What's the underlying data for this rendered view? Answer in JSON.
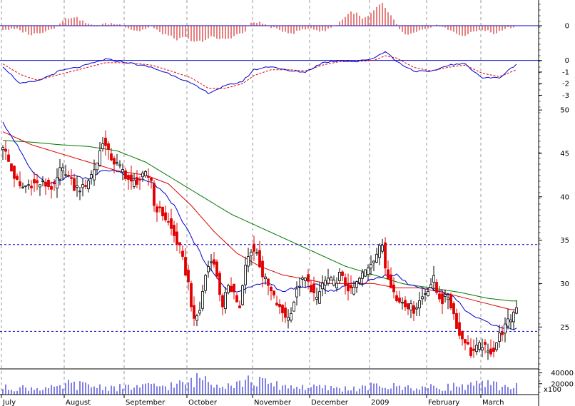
{
  "chart_data": {
    "type": "candlestick",
    "title": "",
    "colors": {
      "up_candle": "#000000",
      "down_candle": "#e00000",
      "ma_short": "#0000cc",
      "ma_medium": "#dd0000",
      "ma_long": "#007700",
      "histogram": "#cc0000",
      "signal": "#dd0000",
      "reference_line": "#0000cc",
      "volume": "#0000cc"
    },
    "x_axis": {
      "months": [
        {
          "label": "July",
          "bar": 0
        },
        {
          "label": "August",
          "bar": 22
        },
        {
          "label": "September",
          "bar": 43
        },
        {
          "label": "October",
          "bar": 65
        },
        {
          "label": "November",
          "bar": 88
        },
        {
          "label": "December",
          "bar": 108
        },
        {
          "label": "2009",
          "bar": 129
        },
        {
          "label": "February",
          "bar": 149
        },
        {
          "label": "March",
          "bar": 168
        }
      ],
      "total_bars": 181
    },
    "price_axis": {
      "ylim": [
        20.5,
        51
      ],
      "ticks": [
        25,
        30,
        35,
        40,
        45,
        50
      ],
      "reference_levels": [
        24.5,
        34.5
      ],
      "grid": "vertical-dashed"
    },
    "histogram_axis": {
      "ylim": [
        -3.2,
        3.2
      ],
      "ticks": [
        0
      ]
    },
    "momentum_axis": {
      "ylim": [
        -3.4,
        0.9
      ],
      "ticks": [
        0,
        -1,
        -2,
        -3
      ]
    },
    "volume_axis": {
      "ylim": [
        0,
        46000
      ],
      "ticks": [
        20000,
        40000
      ],
      "unit_label": "x100"
    },
    "price_anchors": [
      [
        0,
        46
      ],
      [
        3,
        43
      ],
      [
        6,
        41
      ],
      [
        10,
        41.5
      ],
      [
        14,
        41.5
      ],
      [
        18,
        41
      ],
      [
        20,
        43
      ],
      [
        22,
        43
      ],
      [
        25,
        41
      ],
      [
        28,
        41
      ],
      [
        31,
        42.5
      ],
      [
        33,
        44
      ],
      [
        35,
        46.5
      ],
      [
        37,
        45
      ],
      [
        39,
        44
      ],
      [
        42,
        43
      ],
      [
        45,
        41.5
      ],
      [
        48,
        42
      ],
      [
        50,
        42.5
      ],
      [
        52,
        42
      ],
      [
        53,
        39
      ],
      [
        56,
        38
      ],
      [
        58,
        37
      ],
      [
        60,
        35.5
      ],
      [
        62,
        34
      ],
      [
        65,
        30
      ],
      [
        67,
        25.5
      ],
      [
        69,
        27
      ],
      [
        71,
        31
      ],
      [
        73,
        33
      ],
      [
        75,
        31
      ],
      [
        77,
        27
      ],
      [
        79,
        30
      ],
      [
        81,
        29
      ],
      [
        83,
        27
      ],
      [
        85,
        32
      ],
      [
        87,
        34
      ],
      [
        89,
        33.5
      ],
      [
        91,
        31
      ],
      [
        94,
        29
      ],
      [
        97,
        27
      ],
      [
        100,
        26
      ],
      [
        102,
        28
      ],
      [
        104,
        30
      ],
      [
        106,
        30.5
      ],
      [
        108,
        29.5
      ],
      [
        110,
        28
      ],
      [
        112,
        30
      ],
      [
        114,
        30.5
      ],
      [
        116,
        30
      ],
      [
        118,
        31
      ],
      [
        120,
        30
      ],
      [
        122,
        29
      ],
      [
        124,
        30
      ],
      [
        126,
        31
      ],
      [
        128,
        32
      ],
      [
        130,
        33
      ],
      [
        132,
        34
      ],
      [
        133,
        34.5
      ],
      [
        134,
        32
      ],
      [
        136,
        30
      ],
      [
        138,
        28
      ],
      [
        140,
        28
      ],
      [
        142,
        27.5
      ],
      [
        144,
        27
      ],
      [
        146,
        28
      ],
      [
        148,
        29
      ],
      [
        150,
        30
      ],
      [
        151,
        30.5
      ],
      [
        152,
        29
      ],
      [
        154,
        28
      ],
      [
        156,
        28.5
      ],
      [
        158,
        26.5
      ],
      [
        160,
        24
      ],
      [
        162,
        23.5
      ],
      [
        164,
        22
      ],
      [
        166,
        22.5
      ],
      [
        168,
        23
      ],
      [
        170,
        22
      ],
      [
        172,
        22.5
      ],
      [
        174,
        24
      ],
      [
        176,
        25
      ],
      [
        178,
        26
      ],
      [
        180,
        27.5
      ]
    ],
    "histogram_anchors": [
      [
        0,
        -0.5
      ],
      [
        5,
        -0.5
      ],
      [
        10,
        -1.2
      ],
      [
        14,
        -0.8
      ],
      [
        18,
        -0.3
      ],
      [
        20,
        0.4
      ],
      [
        22,
        0.9
      ],
      [
        25,
        1.2
      ],
      [
        28,
        0.6
      ],
      [
        30,
        0.2
      ],
      [
        32,
        -0.1
      ],
      [
        35,
        0.2
      ],
      [
        38,
        0.3
      ],
      [
        42,
        0.1
      ],
      [
        45,
        -0.5
      ],
      [
        48,
        -0.7
      ],
      [
        50,
        -0.4
      ],
      [
        52,
        -0.1
      ],
      [
        55,
        -0.9
      ],
      [
        58,
        -1.3
      ],
      [
        61,
        -1.8
      ],
      [
        64,
        -1.6
      ],
      [
        67,
        -2.2
      ],
      [
        70,
        -2.0
      ],
      [
        73,
        -1.5
      ],
      [
        76,
        -1.8
      ],
      [
        79,
        -1.7
      ],
      [
        82,
        -1.2
      ],
      [
        85,
        -0.8
      ],
      [
        87,
        0.4
      ],
      [
        89,
        0.5
      ],
      [
        91,
        0.3
      ],
      [
        93,
        0.0
      ],
      [
        96,
        -0.5
      ],
      [
        99,
        -0.8
      ],
      [
        102,
        -1.0
      ],
      [
        104,
        -0.6
      ],
      [
        106,
        -0.5
      ],
      [
        108,
        -0.3
      ],
      [
        110,
        -0.6
      ],
      [
        112,
        -0.8
      ],
      [
        114,
        -0.4
      ],
      [
        116,
        -0.1
      ],
      [
        118,
        0.5
      ],
      [
        120,
        1.2
      ],
      [
        122,
        1.8
      ],
      [
        124,
        1.6
      ],
      [
        126,
        0.9
      ],
      [
        128,
        1.2
      ],
      [
        130,
        2.0
      ],
      [
        132,
        2.7
      ],
      [
        133,
        2.9
      ],
      [
        135,
        1.8
      ],
      [
        137,
        0.8
      ],
      [
        139,
        -0.6
      ],
      [
        141,
        -1.2
      ],
      [
        144,
        -1.0
      ],
      [
        147,
        -0.6
      ],
      [
        150,
        -0.4
      ],
      [
        152,
        0.2
      ],
      [
        154,
        -0.1
      ],
      [
        156,
        -0.5
      ],
      [
        158,
        -0.9
      ],
      [
        160,
        -1.2
      ],
      [
        162,
        -1.3
      ],
      [
        165,
        -0.8
      ],
      [
        168,
        -0.5
      ],
      [
        170,
        -0.7
      ],
      [
        172,
        -1.1
      ],
      [
        174,
        -0.8
      ],
      [
        176,
        -0.4
      ],
      [
        178,
        -0.2
      ],
      [
        180,
        -0.1
      ]
    ],
    "momentum_anchors": [
      [
        0,
        -0.5
      ],
      [
        6,
        -2.0
      ],
      [
        12,
        -1.8
      ],
      [
        20,
        -0.9
      ],
      [
        28,
        -0.5
      ],
      [
        36,
        0.1
      ],
      [
        44,
        -0.2
      ],
      [
        52,
        -0.6
      ],
      [
        60,
        -1.3
      ],
      [
        66,
        -2.0
      ],
      [
        72,
        -2.8
      ],
      [
        78,
        -2.2
      ],
      [
        84,
        -1.8
      ],
      [
        88,
        -0.8
      ],
      [
        94,
        -0.5
      ],
      [
        100,
        -0.9
      ],
      [
        106,
        -1.0
      ],
      [
        112,
        -0.2
      ],
      [
        118,
        0.0
      ],
      [
        124,
        -0.1
      ],
      [
        130,
        0.2
      ],
      [
        134,
        0.8
      ],
      [
        138,
        -0.1
      ],
      [
        144,
        -0.9
      ],
      [
        150,
        -1.0
      ],
      [
        156,
        -0.4
      ],
      [
        162,
        -0.3
      ],
      [
        168,
        -1.5
      ],
      [
        174,
        -1.5
      ],
      [
        180,
        -0.3
      ]
    ],
    "signal_anchors": [
      [
        0,
        -0.3
      ],
      [
        6,
        -1.2
      ],
      [
        12,
        -1.7
      ],
      [
        20,
        -1.2
      ],
      [
        28,
        -0.7
      ],
      [
        36,
        -0.2
      ],
      [
        44,
        -0.2
      ],
      [
        52,
        -0.4
      ],
      [
        60,
        -1.0
      ],
      [
        66,
        -1.5
      ],
      [
        72,
        -2.4
      ],
      [
        78,
        -2.4
      ],
      [
        84,
        -2.0
      ],
      [
        88,
        -1.3
      ],
      [
        94,
        -0.8
      ],
      [
        100,
        -0.8
      ],
      [
        106,
        -0.9
      ],
      [
        112,
        -0.4
      ],
      [
        118,
        -0.1
      ],
      [
        124,
        -0.1
      ],
      [
        130,
        0.0
      ],
      [
        134,
        0.4
      ],
      [
        138,
        0.2
      ],
      [
        144,
        -0.6
      ],
      [
        150,
        -0.9
      ],
      [
        156,
        -0.6
      ],
      [
        162,
        -0.4
      ],
      [
        168,
        -1.1
      ],
      [
        174,
        -1.4
      ],
      [
        180,
        -0.8
      ]
    ],
    "volume_anchors": [
      [
        0,
        12000
      ],
      [
        20,
        11000
      ],
      [
        22,
        18000
      ],
      [
        40,
        12000
      ],
      [
        60,
        16000
      ],
      [
        65,
        20000
      ],
      [
        70,
        30000
      ],
      [
        75,
        22000
      ],
      [
        80,
        18000
      ],
      [
        88,
        25000
      ],
      [
        95,
        16000
      ],
      [
        110,
        12000
      ],
      [
        125,
        10000
      ],
      [
        130,
        15000
      ],
      [
        140,
        13000
      ],
      [
        150,
        12000
      ],
      [
        160,
        15000
      ],
      [
        170,
        17000
      ],
      [
        180,
        14000
      ]
    ],
    "ma_short_anchors": [
      [
        0,
        48.5
      ],
      [
        5,
        46
      ],
      [
        10,
        43
      ],
      [
        15,
        41.5
      ],
      [
        20,
        42
      ],
      [
        25,
        42.5
      ],
      [
        30,
        42
      ],
      [
        35,
        43
      ],
      [
        40,
        43
      ],
      [
        45,
        42
      ],
      [
        50,
        42
      ],
      [
        55,
        41
      ],
      [
        60,
        39
      ],
      [
        65,
        36
      ],
      [
        70,
        33
      ],
      [
        74,
        31
      ],
      [
        78,
        29.5
      ],
      [
        82,
        29
      ],
      [
        86,
        29.5
      ],
      [
        90,
        30
      ],
      [
        94,
        30
      ],
      [
        98,
        29
      ],
      [
        102,
        29.5
      ],
      [
        106,
        29.5
      ],
      [
        110,
        30
      ],
      [
        114,
        29
      ],
      [
        118,
        29.5
      ],
      [
        122,
        30
      ],
      [
        126,
        30
      ],
      [
        130,
        30.5
      ],
      [
        134,
        31
      ],
      [
        138,
        31
      ],
      [
        142,
        30
      ],
      [
        146,
        29.5
      ],
      [
        150,
        29.5
      ],
      [
        154,
        29
      ],
      [
        158,
        28.5
      ],
      [
        162,
        27
      ],
      [
        166,
        26
      ],
      [
        170,
        25.5
      ],
      [
        175,
        25
      ],
      [
        178,
        24.8
      ]
    ],
    "ma_medium_anchors": [
      [
        0,
        47.5
      ],
      [
        10,
        46
      ],
      [
        20,
        45
      ],
      [
        30,
        44
      ],
      [
        40,
        43
      ],
      [
        50,
        42.5
      ],
      [
        58,
        41.5
      ],
      [
        66,
        39
      ],
      [
        74,
        36
      ],
      [
        82,
        33.5
      ],
      [
        90,
        32
      ],
      [
        98,
        31
      ],
      [
        106,
        30.5
      ],
      [
        114,
        30
      ],
      [
        122,
        30
      ],
      [
        130,
        30
      ],
      [
        138,
        29.5
      ],
      [
        146,
        29.5
      ],
      [
        154,
        29
      ],
      [
        160,
        28.5
      ],
      [
        166,
        28
      ],
      [
        172,
        27.5
      ],
      [
        178,
        27
      ]
    ],
    "ma_long_anchors": [
      [
        0,
        46.5
      ],
      [
        10,
        46.3
      ],
      [
        20,
        46
      ],
      [
        30,
        45.8
      ],
      [
        40,
        45.3
      ],
      [
        50,
        44
      ],
      [
        60,
        42
      ],
      [
        70,
        40
      ],
      [
        80,
        38
      ],
      [
        90,
        36.5
      ],
      [
        100,
        35
      ],
      [
        110,
        33.5
      ],
      [
        120,
        32
      ],
      [
        130,
        31
      ],
      [
        140,
        30
      ],
      [
        150,
        29.5
      ],
      [
        160,
        29
      ],
      [
        170,
        28.3
      ],
      [
        178,
        28
      ]
    ]
  }
}
